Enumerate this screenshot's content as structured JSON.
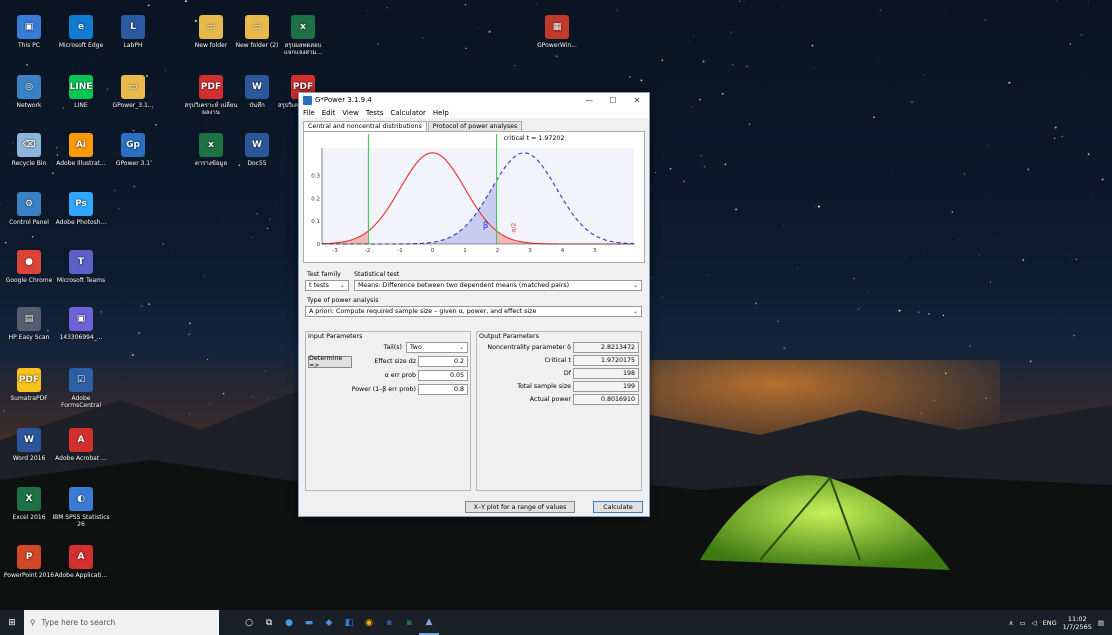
{
  "desktop": {
    "icons": [
      {
        "label": "This PC",
        "color": "#3a7bd5",
        "glyph": "▣"
      },
      {
        "label": "Microsoft Edge",
        "color": "#0f7bd1",
        "glyph": "e"
      },
      {
        "label": "LabPH",
        "color": "#2c5aa0",
        "glyph": "L"
      },
      {
        "label": "New folder",
        "color": "#e6b94a",
        "glyph": "▭"
      },
      {
        "label": "New folder (2)",
        "color": "#e6b94a",
        "glyph": "▭"
      },
      {
        "label": "สรุปผลทดสอบ แจกแจงสาม...",
        "color": "#1e7145",
        "glyph": "x"
      },
      {
        "label": "GPowerWin...",
        "color": "#c0392b",
        "glyph": "▦"
      },
      {
        "label": "Network",
        "color": "#3b82c4",
        "glyph": "◎"
      },
      {
        "label": "LINE",
        "color": "#06c755",
        "glyph": "LINE"
      },
      {
        "label": "GPower_3.1...",
        "color": "#e6b94a",
        "glyph": "▭"
      },
      {
        "label": "สรุปวิเคราะห์ เปลี่ยน ผลงาน",
        "color": "#d32f2f",
        "glyph": "PDF"
      },
      {
        "label": "บันทึก",
        "color": "#2b579a",
        "glyph": "W"
      },
      {
        "label": "สรุปวิเคราะห์ สาขาวิชา",
        "color": "#d32f2f",
        "glyph": "PDF"
      },
      {
        "label": "Recycle Bin",
        "color": "#8fb5d8",
        "glyph": "⌫"
      },
      {
        "label": "Adobe Illustrat...",
        "color": "#ff9a00",
        "glyph": "Ai"
      },
      {
        "label": "GPower 3.1",
        "color": "#2a6fc4",
        "glyph": "Gp"
      },
      {
        "label": "ตารางข้อมูล",
        "color": "#1e7145",
        "glyph": "x"
      },
      {
        "label": "Doc55",
        "color": "#2b579a",
        "glyph": "W"
      },
      {
        "label": "Control Panel",
        "color": "#3b82c4",
        "glyph": "⚙"
      },
      {
        "label": "Adobe Photosh...",
        "color": "#31a8ff",
        "glyph": "Ps"
      },
      {
        "label": "Google Chrome",
        "color": "#db4437",
        "glyph": "●"
      },
      {
        "label": "Microsoft Teams",
        "color": "#5b5fc7",
        "glyph": "T"
      },
      {
        "label": "HP Easy Scan",
        "color": "#555d6e",
        "glyph": "▤"
      },
      {
        "label": "143306994_...",
        "color": "#6c63d8",
        "glyph": "▣"
      },
      {
        "label": "SumatraPDF",
        "color": "#f6c21b",
        "glyph": "PDF"
      },
      {
        "label": "Adobe FormsCentral",
        "color": "#2d5fa6",
        "glyph": "☑"
      },
      {
        "label": "Word 2016",
        "color": "#2b579a",
        "glyph": "W"
      },
      {
        "label": "Adobe Acrobat ...",
        "color": "#d32f2f",
        "glyph": "A"
      },
      {
        "label": "Excel 2016",
        "color": "#1e7145",
        "glyph": "X"
      },
      {
        "label": "IBM SPSS Statistics 26",
        "color": "#3a7bd5",
        "glyph": "◐"
      },
      {
        "label": "PowerPoint 2016",
        "color": "#d24726",
        "glyph": "P"
      },
      {
        "label": "Adobe Applicati...",
        "color": "#d32f2f",
        "glyph": "A"
      }
    ]
  },
  "window": {
    "title": "G*Power 3.1.9.4",
    "menu": [
      "File",
      "Edit",
      "View",
      "Tests",
      "Calculator",
      "Help"
    ],
    "tabs": [
      "Central and noncentral distributions",
      "Protocol of power analyses"
    ],
    "plot": {
      "critical_label": "critical t = 1.97202",
      "x_ticks": [
        "-3",
        "-2",
        "-1",
        "0",
        "1",
        "2",
        "3",
        "4",
        "5"
      ],
      "y_ticks": [
        "0.3",
        "0.2",
        "0.1",
        "0"
      ],
      "beta_label": "β",
      "alpha_label": "α/2"
    },
    "test_family_label": "Test family",
    "test_family_value": "t tests",
    "statistical_test_label": "Statistical test",
    "statistical_test_value": "Means: Difference between two dependent means (matched pairs)",
    "power_analysis_label": "Type of power analysis",
    "power_analysis_value": "A priori: Compute required sample size – given α, power, and effect size",
    "input": {
      "title": "Input Parameters",
      "tails_label": "Tail(s)",
      "tails_value": "Two",
      "determine_label": "Determine =>",
      "effect_label": "Effect size dz",
      "effect_value": "0.2",
      "alpha_label": "α err prob",
      "alpha_value": "0.05",
      "power_label": "Power (1–β err prob)",
      "power_value": "0.8"
    },
    "output": {
      "title": "Output Parameters",
      "rows": [
        {
          "label": "Noncentrality parameter δ",
          "value": "2.8213472"
        },
        {
          "label": "Critical t",
          "value": "1.9720175"
        },
        {
          "label": "Df",
          "value": "198"
        },
        {
          "label": "Total sample size",
          "value": "199"
        },
        {
          "label": "Actual power",
          "value": "0.8016910"
        }
      ]
    },
    "xy_button": "X–Y plot for a range of values",
    "calculate_button": "Calculate"
  },
  "taskbar": {
    "search_placeholder": "Type here to search",
    "tray_lang": "ENG",
    "time": "11:02",
    "date": "1/7/2565"
  }
}
